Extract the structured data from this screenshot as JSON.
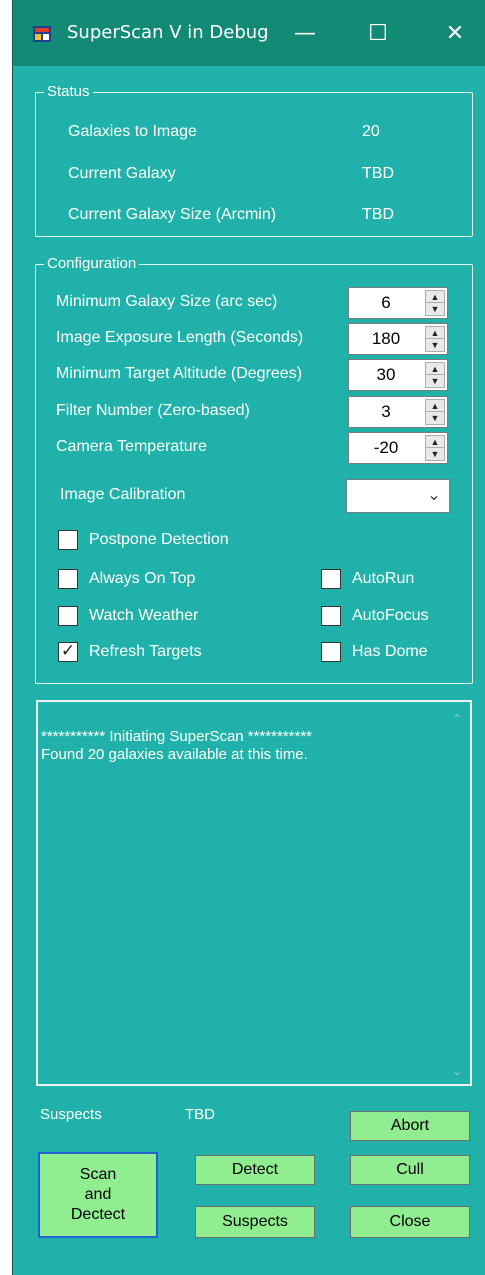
{
  "window": {
    "title": "SuperScan V in Debug",
    "minimize_glyph": "—",
    "maximize_glyph": "☐",
    "close_glyph": "✕"
  },
  "status": {
    "legend": "Status",
    "rows": [
      {
        "label": "Galaxies to Image",
        "value": "20"
      },
      {
        "label": "Current Galaxy",
        "value": "TBD"
      },
      {
        "label": "Current Galaxy Size (Arcmin)",
        "value": "TBD"
      }
    ]
  },
  "configuration": {
    "legend": "Configuration",
    "fields": [
      {
        "label": "Minimum Galaxy Size (arc sec)",
        "value": "6"
      },
      {
        "label": "Image Exposure Length (Seconds)",
        "value": "180"
      },
      {
        "label": "Minimum Target Altitude (Degrees)",
        "value": "30"
      },
      {
        "label": "Filter Number  (Zero-based)",
        "value": "3"
      },
      {
        "label": "Camera Temperature",
        "value": "-20"
      }
    ],
    "calibration_label": "Image Calibration",
    "calibration_value": "",
    "checkboxes": {
      "postpone_detection": {
        "label": "Postpone Detection",
        "checked": false
      },
      "always_on_top": {
        "label": "Always On Top",
        "checked": false
      },
      "watch_weather": {
        "label": "Watch Weather",
        "checked": false
      },
      "refresh_targets": {
        "label": "Refresh Targets",
        "checked": true
      },
      "autorun": {
        "label": "AutoRun",
        "checked": false
      },
      "autofocus": {
        "label": "AutoFocus",
        "checked": false
      },
      "has_dome": {
        "label": "Has Dome",
        "checked": false
      }
    },
    "check_glyph": "✓"
  },
  "log": {
    "text": "*********** Initiating SuperScan ***********\nFound 20 galaxies available at this time."
  },
  "suspects": {
    "label": "Suspects",
    "value": "TBD"
  },
  "buttons": {
    "abort": "Abort",
    "scan_detect": "Scan\nand\nDectect",
    "detect": "Detect",
    "cull": "Cull",
    "suspects": "Suspects",
    "close": "Close"
  },
  "colors": {
    "background": "#20b2aa",
    "title_bar": "#128a76",
    "button": "#90ee90"
  }
}
